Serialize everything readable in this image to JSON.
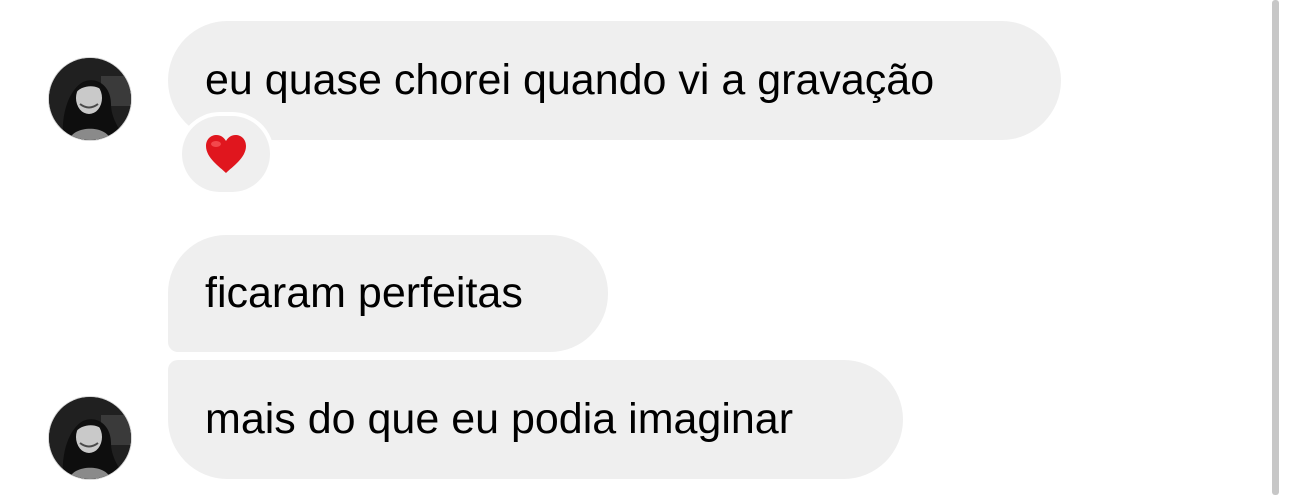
{
  "messages": [
    {
      "text": "eu quase chorei quando vi a gravação",
      "has_avatar": true,
      "reaction": "heart"
    },
    {
      "text": "ficaram perfeitas",
      "has_avatar": false
    },
    {
      "text": "mais do que eu podia imaginar",
      "has_avatar": true
    }
  ],
  "colors": {
    "bubble_background": "#efefef",
    "text": "#000000",
    "reaction_heart": "#e0161e",
    "background": "#ffffff"
  },
  "icons": {
    "reaction": "red-heart-icon",
    "avatar": "profile-photo"
  }
}
